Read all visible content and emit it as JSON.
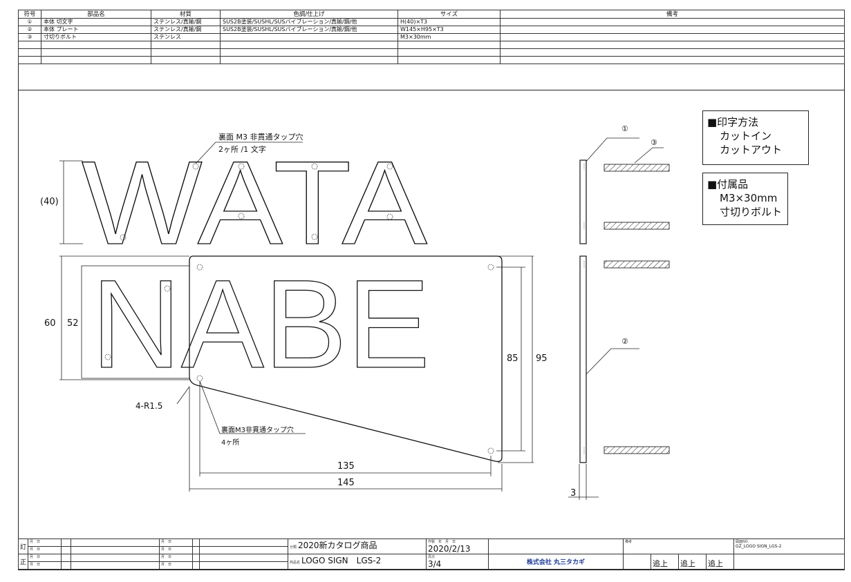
{
  "parts_table": {
    "headers": [
      "符号",
      "部品名",
      "材質",
      "色調/仕上げ",
      "サイズ",
      "備考"
    ],
    "rows": [
      [
        "①",
        "本体 切文字",
        "ステンレス/真鍮/鋼",
        "SUS2B塗装/SUSHL/SUSバイブレーション/真鍮/鋼/他",
        "H(40)×T3",
        ""
      ],
      [
        "②",
        "本体 プレート",
        "ステンレス/真鍮/鋼",
        "SUS2B塗装/SUSHL/SUSバイブレーション/真鍮/鋼/他",
        "W145×H95×T3",
        ""
      ],
      [
        "③",
        "寸切りボルト",
        "ステンレス",
        "",
        "M3×30mm",
        ""
      ],
      [
        "",
        "",
        "",
        "",
        "",
        ""
      ],
      [
        "",
        "",
        "",
        "",
        "",
        ""
      ],
      [
        "",
        "",
        "",
        "",
        "",
        ""
      ]
    ]
  },
  "drawing": {
    "text_top": "WATA",
    "text_bottom": "NABE",
    "label_tap_letters": "裏面 M3 非貫通タップ穴",
    "label_tap_letters_count": "2ヶ所 /1 文字",
    "label_tap_plate": "裏面M3非貫通タップ穴",
    "label_tap_plate_count": "4ヶ所",
    "label_radius": "4-R1.5",
    "dim_letter_height": "(40)",
    "dim_60": "60",
    "dim_52": "52",
    "dim_85": "85",
    "dim_95": "95",
    "dim_135": "135",
    "dim_145": "145",
    "dim_3": "3",
    "marker_1": "①",
    "marker_2": "②",
    "marker_3": "③"
  },
  "notes": {
    "print_title": "■印字方法",
    "print_line1": "カットイン",
    "print_line2": "カットアウト",
    "accessory_title": "■付属品",
    "accessory_line1": "M3×30mm",
    "accessory_line2": "寸切りボルト"
  },
  "title_block": {
    "check_label": "訂",
    "correct_label": "正",
    "month_day": "月　日",
    "category_label": "分類",
    "category_value": "2020新カタログ商品",
    "product_label": "商品名",
    "product_value": "LOGO SIGN　LGS-2",
    "date_label": "作製　年　月　日",
    "date_value": "2020/2/13",
    "page_label": "頁次",
    "page_value": "3/4",
    "company": "株式会社 丸三タカギ",
    "remarks_label": "備考",
    "approval_1": "追上",
    "approval_2": "追上",
    "approval_3": "追上",
    "drawing_no_label": "図面NO.",
    "drawing_no_value": "GZ_LOGO SIGN_LGS-2"
  }
}
